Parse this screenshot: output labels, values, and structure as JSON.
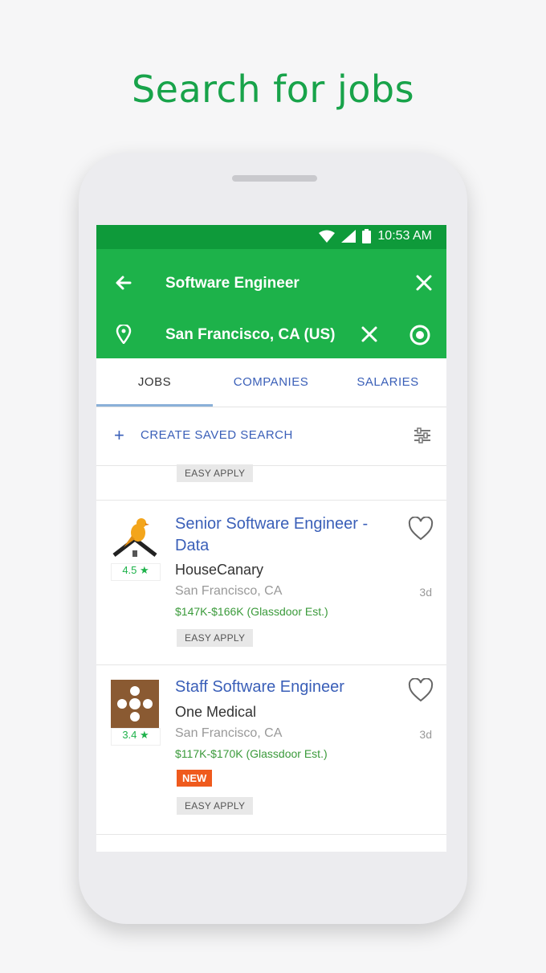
{
  "headline": "Search for jobs",
  "status": {
    "time": "10:53 AM"
  },
  "search": {
    "keyword": "Software Engineer",
    "location": "San Francisco, CA (US)"
  },
  "tabs": [
    {
      "label": "JOBS",
      "active": true
    },
    {
      "label": "COMPANIES",
      "active": false
    },
    {
      "label": "SALARIES",
      "active": false
    }
  ],
  "saved_search_label": "CREATE SAVED SEARCH",
  "partial_badge": "EASY APPLY",
  "jobs": [
    {
      "title": "Senior Software Engineer - Data",
      "company": "HouseCanary",
      "location": "San Francisco, CA",
      "salary": "$147K-$166K (Glassdoor Est.)",
      "rating": "4.5 ★",
      "age": "3d",
      "badge": "EASY APPLY",
      "logo_icon": "canary-house-logo"
    },
    {
      "title": "Staff Software Engineer",
      "company": "One Medical",
      "location": "San Francisco, CA",
      "salary": "$117K-$170K (Glassdoor Est.)",
      "rating": "3.4 ★",
      "age": "3d",
      "new_label": "NEW",
      "badge": "EASY APPLY",
      "logo_icon": "one-medical-logo"
    }
  ],
  "colors": {
    "brand_green": "#1db24a",
    "status_green": "#0e9a3a",
    "link_blue": "#3a5fb8",
    "new_orange": "#ef5a1d"
  }
}
